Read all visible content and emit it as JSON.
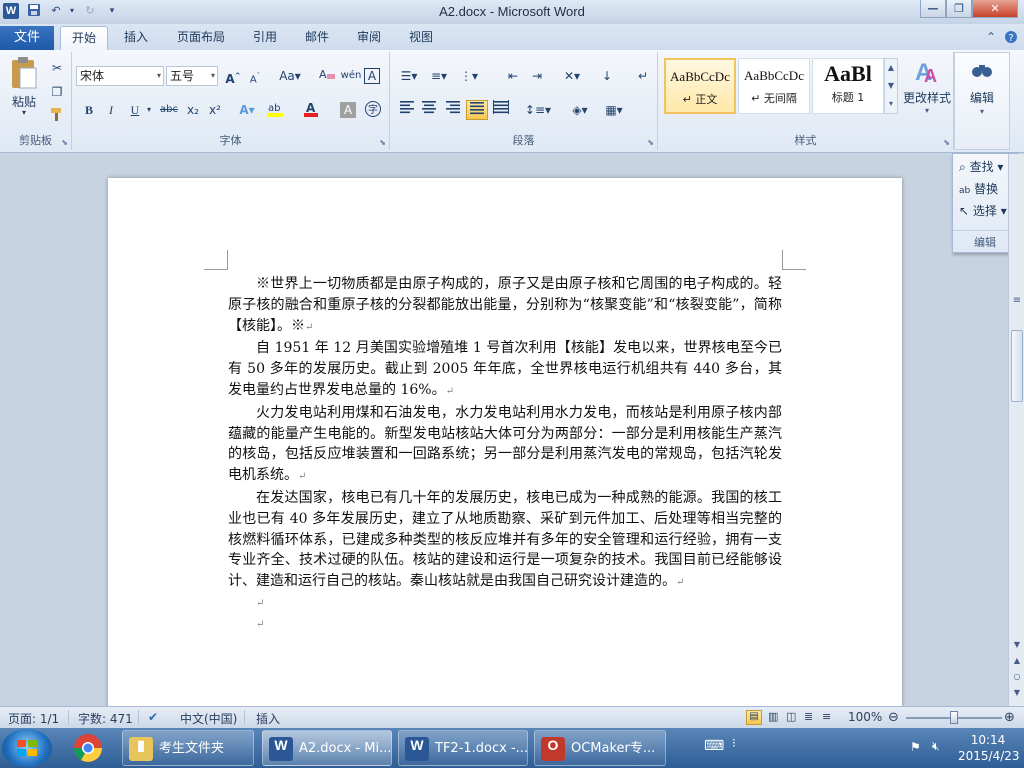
{
  "window": {
    "title": "A2.docx - Microsoft Word",
    "app_icon": "W",
    "qat": [
      "save-icon",
      "undo-icon",
      "redo-icon",
      "customize-icon"
    ]
  },
  "tabs": {
    "file": "文件",
    "items": [
      "开始",
      "插入",
      "页面布局",
      "引用",
      "邮件",
      "审阅",
      "视图"
    ],
    "active": "开始"
  },
  "ribbon": {
    "clipboard": {
      "label": "剪贴板",
      "paste": "粘贴"
    },
    "font": {
      "label": "字体",
      "font_name": "宋体",
      "font_size": "五号",
      "grow": "A",
      "shrink": "A",
      "case": "Aa",
      "clear_format": "",
      "bold": "B",
      "italic": "I",
      "underline": "U",
      "strike": "abc",
      "subscript": "x₂",
      "superscript": "x²",
      "font_color": "A",
      "char_shading": "A",
      "enclose": "字"
    },
    "paragraph": {
      "label": "段落"
    },
    "styles": {
      "label": "样式",
      "items": [
        {
          "sample": "AaBbCcDc",
          "name": "↵ 正文"
        },
        {
          "sample": "AaBbCcDc",
          "name": "↵ 无间隔"
        },
        {
          "sample": "AaBl",
          "name": "标题 1"
        }
      ],
      "change_styles": "更改样式"
    },
    "editing": {
      "label": "编辑"
    }
  },
  "edit_panel": {
    "find": "查找",
    "replace": "替换",
    "select": "选择",
    "label": "编辑"
  },
  "document": {
    "paragraphs": [
      "※世界上一切物质都是由原子构成的，原子又是由原子核和它周围的电子构成的。轻原子核的融合和重原子核的分裂都能放出能量，分别称为“核聚变能”和“核裂变能”，简称【核能】。※",
      "自 1951 年 12 月美国实验增殖堆 1 号首次利用【核能】发电以来，世界核电至今已有 50 多年的发展历史。截止到 2005 年年底，全世界核电运行机组共有 440 多台，其发电量约占世界发电总量的 16%。",
      "火力发电站利用煤和石油发电，水力发电站利用水力发电，而核站是利用原子核内部蕴藏的能量产生电能的。新型发电站核站大体可分为两部分：一部分是利用核能生产蒸汽的核岛，包括反应堆装置和一回路系统；另一部分是利用蒸汽发电的常规岛，包括汽轮发电机系统。",
      "在发达国家，核电已有几十年的发展历史，核电已成为一种成熟的能源。我国的核工业也已有 40 多年发展历史，建立了从地质勘察、采矿到元件加工、后处理等相当完整的核燃料循环体系，已建成多种类型的核反应堆并有多年的安全管理和运行经验，拥有一支专业齐全、技术过硬的队伍。核站的建设和运行是一项复杂的技术。我国目前已经能够设计、建造和运行自己的核站。秦山核站就是由我国自己研究设计建造的。"
    ],
    "para_mark": "↵"
  },
  "status_bar": {
    "page": "页面: 1/1",
    "words": "字数: 471",
    "language": "中文(中国)",
    "mode": "插入",
    "zoom": "100%",
    "zoom_level": 1.0
  },
  "taskbar": {
    "tasks": [
      {
        "label": "考生文件夹",
        "icon": "folder-icon"
      },
      {
        "label": "A2.docx - Mi...",
        "icon": "word-icon",
        "active": true
      },
      {
        "label": "TF2-1.docx -...",
        "icon": "word-icon"
      },
      {
        "label": "OCMaker专...",
        "icon": "ocmaker-icon"
      }
    ],
    "time": "10:14",
    "date": "2015/4/23"
  }
}
